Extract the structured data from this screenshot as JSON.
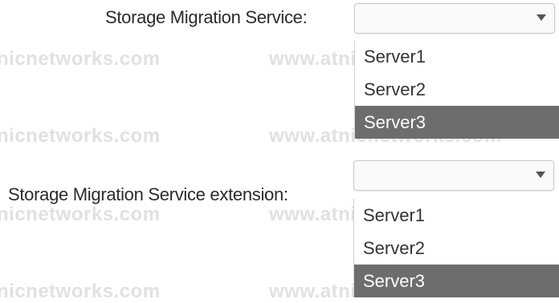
{
  "watermark": {
    "a": "nicnetworks.com",
    "b": "www.atnicnetworks.com"
  },
  "migration_service": {
    "label": "Storage Migration Service:",
    "selected_value": "",
    "options": [
      "Server1",
      "Server2",
      "Server3"
    ],
    "highlighted": "Server3"
  },
  "migration_extension": {
    "label": "Storage Migration Service extension:",
    "selected_value": "",
    "options": [
      "Server1",
      "Server2",
      "Server3"
    ],
    "highlighted": "Server3"
  },
  "colors": {
    "highlight": "#6d6d6d",
    "watermark": "#e1e1e1"
  }
}
